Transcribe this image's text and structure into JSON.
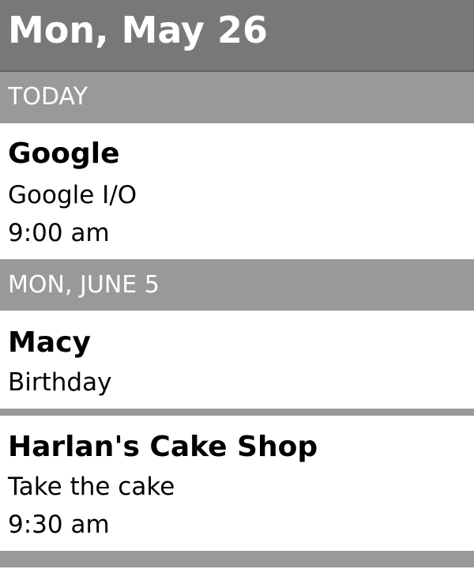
{
  "header": {
    "title": "Mon, May 26"
  },
  "sections": [
    {
      "label": "TODAY",
      "events": [
        {
          "title": "Google",
          "description": "Google I/O",
          "time": "9:00 am"
        }
      ]
    },
    {
      "label": "MON, JUNE 5",
      "events": [
        {
          "title": "Macy",
          "description": "Birthday"
        },
        {
          "title": "Harlan's Cake Shop",
          "description": "Take the cake",
          "time": "9:30 am"
        }
      ]
    }
  ]
}
